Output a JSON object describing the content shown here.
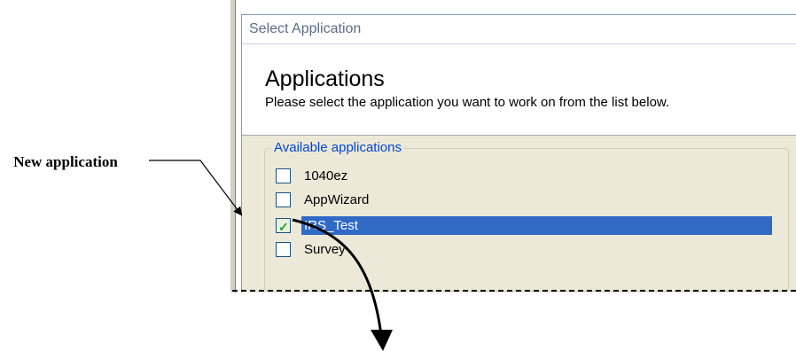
{
  "annotation": {
    "label": "New application"
  },
  "dialog": {
    "title": "Select Application",
    "header_title": "Applications",
    "header_subtitle": "Please select the application you want to work on from the list below.",
    "group_label": "Available applications",
    "applications": [
      {
        "label": "1040ez",
        "checked": false,
        "selected": false
      },
      {
        "label": "AppWizard",
        "checked": false,
        "selected": false
      },
      {
        "label": "IRS_Test",
        "checked": true,
        "selected": true
      },
      {
        "label": "Survey",
        "checked": false,
        "selected": false
      }
    ]
  },
  "colors": {
    "selection": "#316ac5",
    "group_label": "#0046d5",
    "dialog_background": "#ece9d8"
  }
}
